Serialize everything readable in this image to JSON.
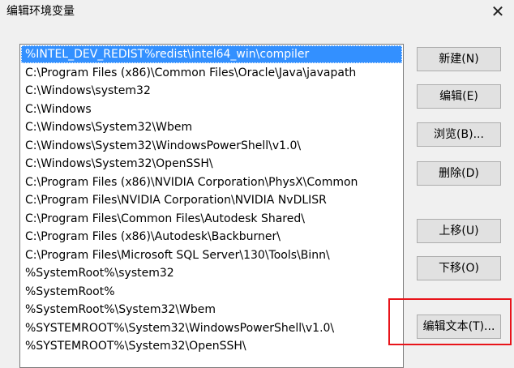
{
  "window": {
    "title": "编辑环境变量",
    "close_glyph": "✕"
  },
  "path_list": {
    "items": [
      "%INTEL_DEV_REDIST%redist\\intel64_win\\compiler",
      "C:\\Program Files (x86)\\Common Files\\Oracle\\Java\\javapath",
      "C:\\Windows\\system32",
      "C:\\Windows",
      "C:\\Windows\\System32\\Wbem",
      "C:\\Windows\\System32\\WindowsPowerShell\\v1.0\\",
      "C:\\Windows\\System32\\OpenSSH\\",
      "C:\\Program Files (x86)\\NVIDIA Corporation\\PhysX\\Common",
      "C:\\Program Files\\NVIDIA Corporation\\NVIDIA NvDLISR",
      "C:\\Program Files\\Common Files\\Autodesk Shared\\",
      "C:\\Program Files (x86)\\Autodesk\\Backburner\\",
      "C:\\Program Files\\Microsoft SQL Server\\130\\Tools\\Binn\\",
      "%SystemRoot%\\system32",
      "%SystemRoot%",
      "%SystemRoot%\\System32\\Wbem",
      "%SYSTEMROOT%\\System32\\WindowsPowerShell\\v1.0\\",
      "%SYSTEMROOT%\\System32\\OpenSSH\\"
    ],
    "selected_index": 0
  },
  "buttons": {
    "new": "新建(N)",
    "edit": "编辑(E)",
    "browse": "浏览(B)...",
    "delete": "删除(D)",
    "move_up": "上移(U)",
    "move_down": "下移(O)",
    "edit_text": "编辑文本(T)..."
  },
  "colors": {
    "selection": "#3390ff",
    "highlight_box": "#e8141a"
  }
}
